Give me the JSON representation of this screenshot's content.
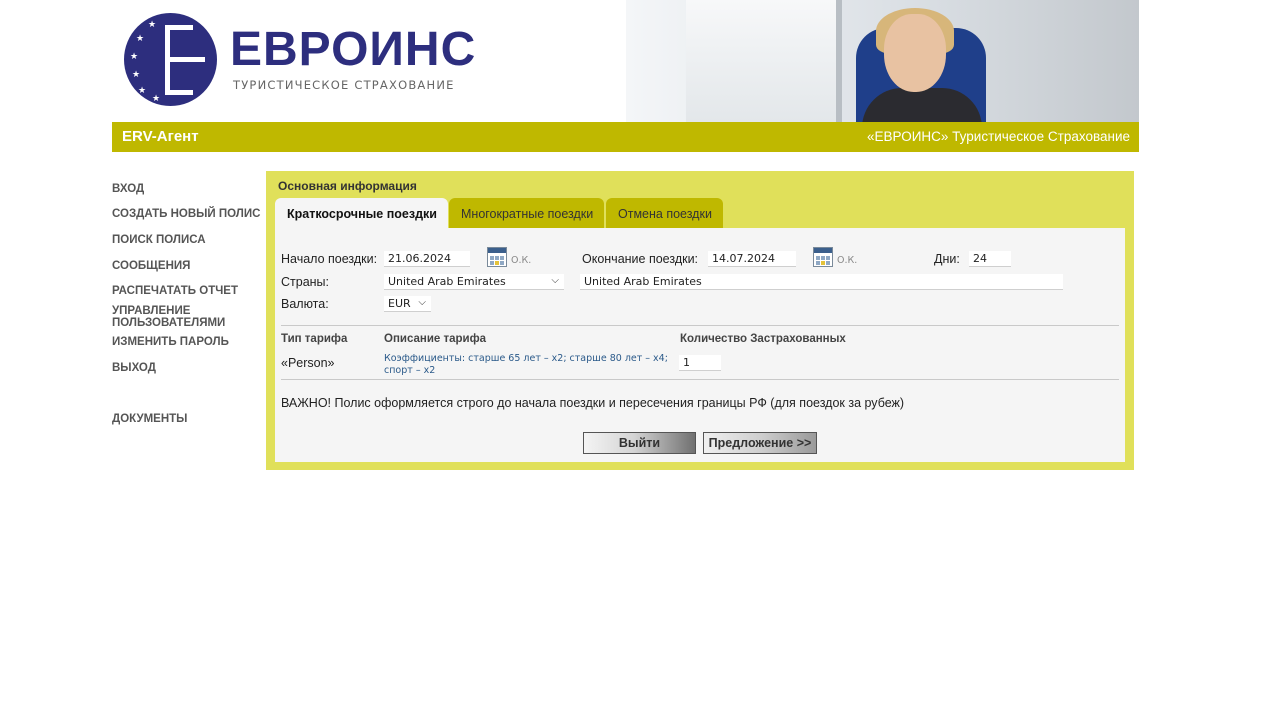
{
  "header": {
    "logo_name": "ЕВРОИНС",
    "logo_subtitle": "ТУРИСТИЧЕСКОЕ СТРАХОВАНИЕ"
  },
  "topbar": {
    "brand": "ERV-Агент",
    "tagline": "«ЕВРОИНС» Туристическое Страхование"
  },
  "menu": {
    "items": [
      "ВХОД",
      "СОЗДАТЬ НОВЫЙ ПОЛИС",
      "ПОИСК ПОЛИСА",
      "СООБЩЕНИЯ",
      "РАСПЕЧАТАТЬ ОТЧЕТ",
      "УПРАВЛЕНИЕ ПОЛЬЗОВАТЕЛЯМИ",
      "ИЗМЕНИТЬ ПАРОЛЬ",
      "ВЫХОД",
      "ДОКУМЕНТЫ"
    ]
  },
  "panel": {
    "title": "Основная информация",
    "tabs": [
      "Краткосрочные поездки",
      "Многократные поездки",
      "Отмена поездки"
    ],
    "active_tab": 0
  },
  "form": {
    "start_label": "Начало поездки:",
    "start_value": "21.06.2024",
    "end_label": "Окончание поездки:",
    "end_value": "14.07.2024",
    "ok_text": "О.К.",
    "days_label": "Дни:",
    "days_value": "24",
    "countries_label": "Страны:",
    "country_selected": "United Arab Emirates",
    "countries_list": "United Arab Emirates",
    "currency_label": "Валюта:",
    "currency_selected": "EUR"
  },
  "tariff": {
    "col_type": "Тип тарифа",
    "col_desc": "Описание тарифа",
    "col_qty": "Количество Застрахованных",
    "type": "«Person»",
    "description": "Коэффициенты: старше 65 лет – x2; старше 80 лет – x4; спорт – x2",
    "quantity": "1"
  },
  "notice": "ВАЖНО! Полис оформляется строго до начала поездки и пересечения границы РФ (для поездок за рубеж)",
  "buttons": {
    "exit": "Выйти",
    "offer": "Предложение >>"
  },
  "colors": {
    "olive": "#bfb800",
    "panel": "#e0e05a",
    "logo_blue": "#2d2e7e"
  }
}
